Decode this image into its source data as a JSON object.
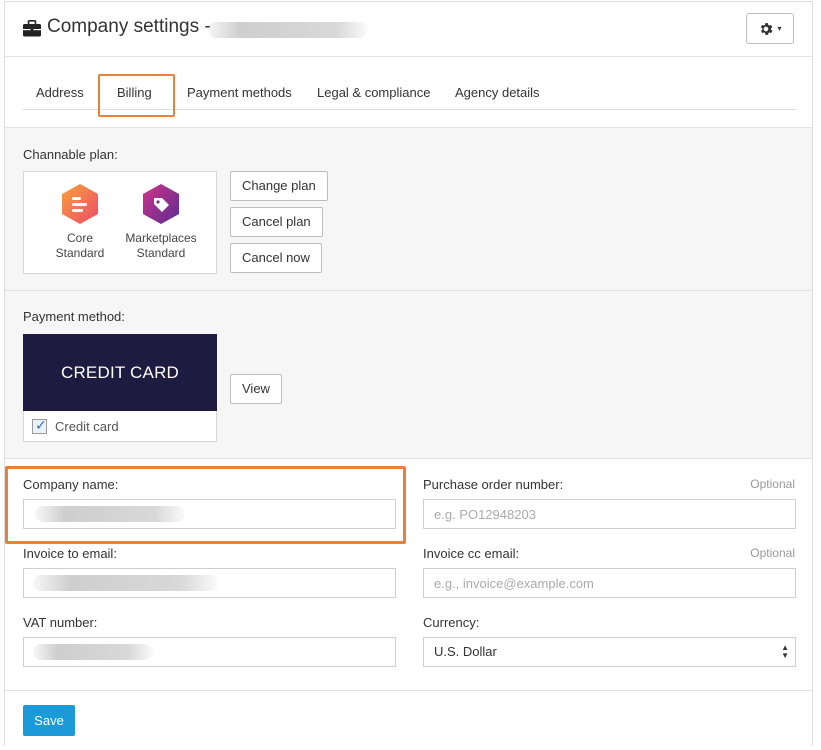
{
  "header": {
    "title": "Company settings -",
    "settings_icon": "gear-icon",
    "dropdown_caret": "▾"
  },
  "tabs": [
    {
      "label": "Address"
    },
    {
      "label": "Billing",
      "active": true
    },
    {
      "label": "Payment methods"
    },
    {
      "label": "Legal & compliance"
    },
    {
      "label": "Agency details"
    }
  ],
  "plan": {
    "label": "Channable plan:",
    "items": [
      {
        "line1": "Core",
        "line2": "Standard",
        "icon": "core-standard-icon"
      },
      {
        "line1": "Marketplaces",
        "line2": "Standard",
        "icon": "marketplaces-standard-icon"
      }
    ],
    "buttons": {
      "change": "Change plan",
      "cancel": "Cancel plan",
      "cancel_now": "Cancel now"
    }
  },
  "payment": {
    "label": "Payment method:",
    "card_banner": "CREDIT CARD",
    "card_checkbox_label": "Credit card",
    "view_button": "View"
  },
  "form": {
    "company_name_label": "Company name:",
    "po_label": "Purchase order number:",
    "po_optional": "Optional",
    "po_placeholder": "e.g. PO12948203",
    "invoice_email_label": "Invoice to email:",
    "cc_email_label": "Invoice cc email:",
    "cc_optional": "Optional",
    "cc_placeholder": "e.g., invoice@example.com",
    "vat_label": "VAT number:",
    "currency_label": "Currency:",
    "currency_value": "U.S. Dollar"
  },
  "footer": {
    "save_label": "Save"
  },
  "colors": {
    "accent": "#1a9bd7",
    "highlight": "#e8823a",
    "card_banner": "#1d1b3f"
  }
}
